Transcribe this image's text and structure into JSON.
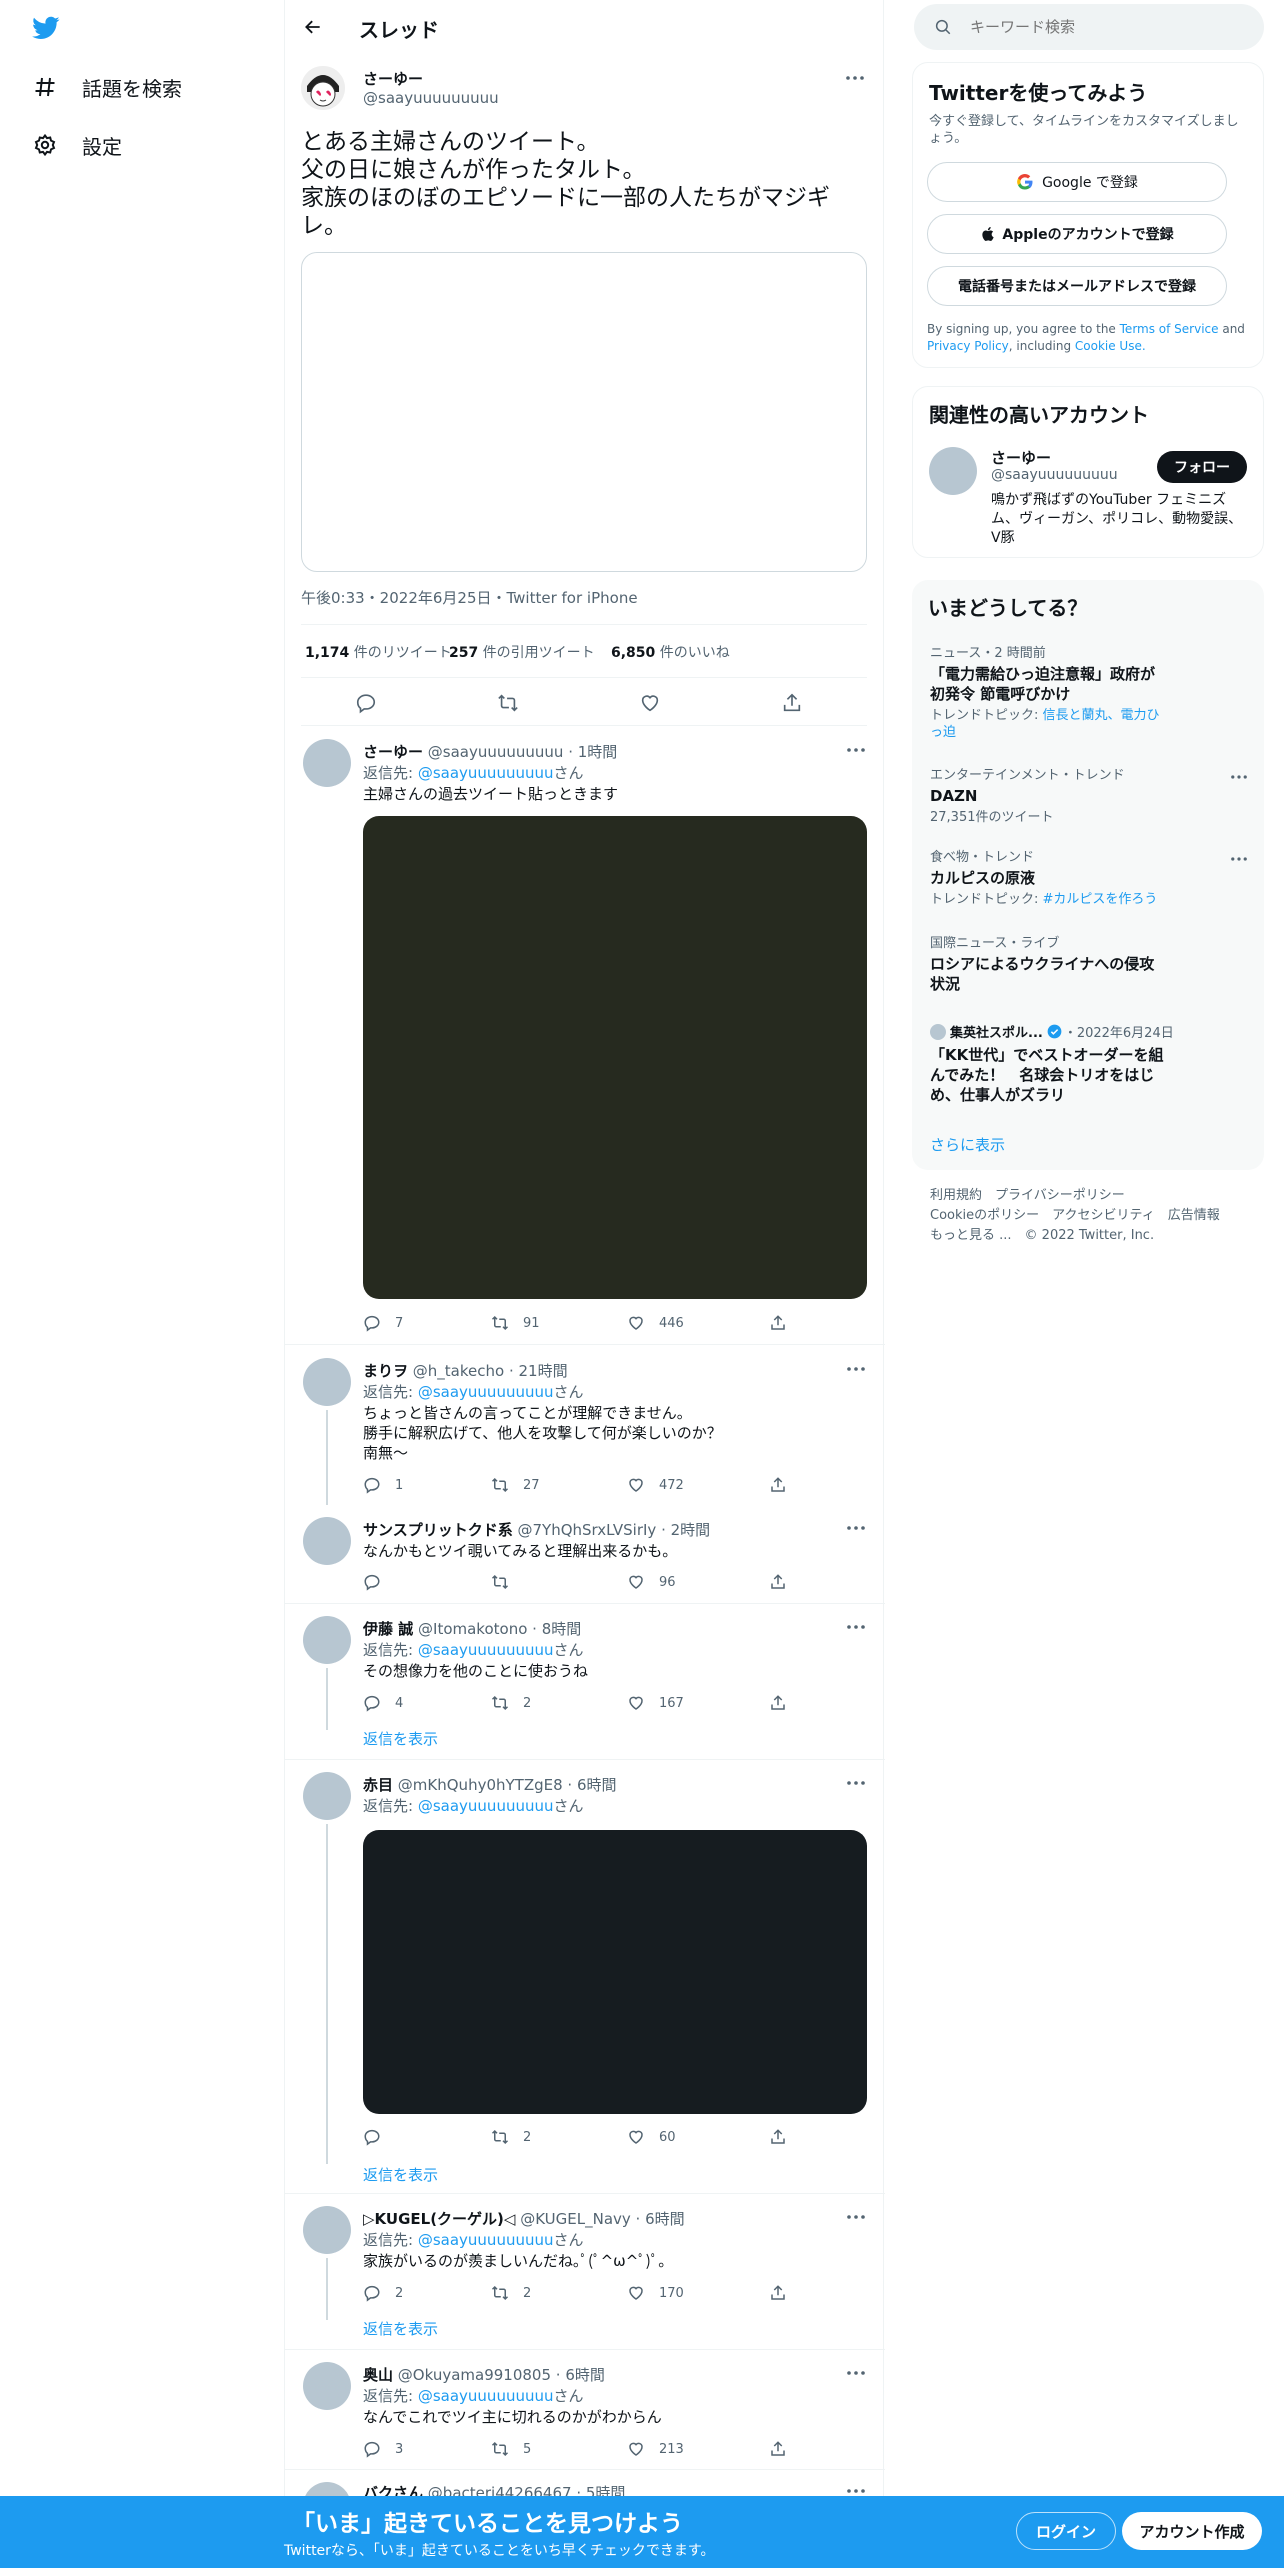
{
  "nav": {
    "items": [
      {
        "label": "話題を検索",
        "icon": "hashtag-icon"
      },
      {
        "label": "設定",
        "icon": "gear-icon"
      }
    ]
  },
  "header": {
    "title": "スレッド"
  },
  "main_tweet": {
    "name": "さーゆー",
    "handle": "@saayuuuuuuuuu",
    "text": "とある主婦さんのツイート。\n父の日に娘さんが作ったタルト。\n家族のほのぼのエピソードに一部の人たちがマジギレ。",
    "meta": "午後0:33・2022年6月25日・Twitter for iPhone",
    "stats": {
      "retweets": "1,174",
      "retweets_label": "件のリツイート",
      "quotes": "257",
      "quotes_label": "件の引用ツイート",
      "likes": "6,850",
      "likes_label": "件のいいね"
    }
  },
  "replies": [
    {
      "name": "さーゆー",
      "handle": "@saayuuuuuuuuu",
      "time": "1時間",
      "reply_to": "返信先:",
      "reply_handle": "@saayuuuuuuuuu",
      "reply_suffix": "さん",
      "text": "主婦さんの過去ツイート貼っときます",
      "replies": "7",
      "retweets": "91",
      "likes": "446",
      "media_color": "#262a1f"
    },
    {
      "name": "まりヲ",
      "handle": "@h_takecho",
      "time": "21時間",
      "reply_to": "返信先:",
      "reply_handle": "@saayuuuuuuuuu",
      "reply_suffix": "さん",
      "text": "ちょっと皆さんの言ってことが理解できません。\n勝手に解釈広げて、他人を攻撃して何が楽しいのか？\n南無〜",
      "replies": "1",
      "retweets": "27",
      "likes": "472"
    },
    {
      "name": "サンスプリットクド系",
      "handle": "@7YhQhSrxLVSirIy",
      "time": "2時間",
      "text": "なんかもとツイ覗いてみると理解出来るかも。",
      "replies": "",
      "retweets": "",
      "likes": "96"
    },
    {
      "name": "伊藤 誠",
      "handle": "@Itomakotono",
      "time": "8時間",
      "reply_to": "返信先:",
      "reply_handle": "@saayuuuuuuuuu",
      "reply_suffix": "さん",
      "text": "その想像力を他のことに使おうね",
      "replies": "4",
      "retweets": "2",
      "likes": "167",
      "show_replies": "返信を表示"
    },
    {
      "name": "赤目",
      "handle": "@mKhQuhy0hYTZgE8",
      "time": "6時間",
      "reply_to": "返信先:",
      "reply_handle": "@saayuuuuuuuuu",
      "reply_suffix": "さん",
      "replies": "",
      "retweets": "2",
      "likes": "60",
      "show_replies": "返信を表示",
      "media_color": "#161c20"
    },
    {
      "name": "▷KUGEL(クーゲル)◁",
      "handle": "@KUGEL_Navy",
      "time": "6時間",
      "reply_to": "返信先:",
      "reply_handle": "@saayuuuuuuuuu",
      "reply_suffix": "さん",
      "text": "家族がいるのが羨ましいんだね｡ﾟ(ﾟ^ω^ﾟ)ﾟ｡",
      "replies": "2",
      "retweets": "2",
      "likes": "170",
      "show_replies": "返信を表示"
    },
    {
      "name": "奥山",
      "handle": "@Okuyama9910805",
      "time": "6時間",
      "reply_to": "返信先:",
      "reply_handle": "@saayuuuuuuuuu",
      "reply_suffix": "さん",
      "text": "なんでこれでツイ主に切れるのかがわからん",
      "replies": "3",
      "retweets": "5",
      "likes": "213"
    },
    {
      "name": "バクさん",
      "handle": "@bacteri44266467",
      "time": "5時間"
    }
  ],
  "search": {
    "placeholder": "キーワード検索"
  },
  "signup": {
    "title": "Twitterを使ってみよう",
    "subtitle": "今すぐ登録して、タイムラインをカスタマイズしましょう。",
    "google": "Google で登録",
    "apple": "Appleのアカウントで登録",
    "phone": "電話番号またはメールアドレスで登録",
    "terms_prefix": "By signing up, you agree to the ",
    "terms": "Terms of Service",
    "and": " and ",
    "privacy": "Privacy Policy",
    "including": ", including ",
    "cookie": "Cookie Use."
  },
  "related": {
    "title": "関連性の高いアカウント",
    "name": "さーゆー",
    "handle": "@saayuuuuuuuuu",
    "follow": "フォロー",
    "bio": "鳴かず飛ばずのYouTuber フェミニズム、ヴィーガン、ポリコレ、動物愛誤、V豚"
  },
  "trends": {
    "title": "いまどうしてる？",
    "items": [
      {
        "category": "ニュース・2 時間前",
        "title": "「電力需給ひっ迫注意報」政府が\n初発令 節電呼びかけ",
        "sub_prefix": "トレンドトピック: ",
        "sub_link": "信長と蘭丸、電力ひっ迫"
      },
      {
        "category": "エンターテインメント・トレンド",
        "title": "DAZN",
        "sub": "27,351件のツイート"
      },
      {
        "category": "食べ物・トレンド",
        "title": "カルピスの原液",
        "sub_prefix": "トレンドトピック: ",
        "sub_link": "#カルピスを作ろう"
      },
      {
        "category": "国際ニュース・ライブ",
        "title": "ロシアによるウクライナへの侵攻\n状況"
      },
      {
        "source": "集英社スポル...",
        "date": "・2022年6月24日",
        "title": "「KK世代」でベストオーダーを組\nんでみた！　名球会トリオをはじ\nめ、仕事人がズラリ"
      }
    ],
    "show_more": "さらに表示"
  },
  "footer": {
    "line1": [
      "利用規約",
      "プライバシーポリシー"
    ],
    "line2": [
      "Cookieのポリシー",
      "アクセシビリティ",
      "広告情報"
    ],
    "line3": [
      "もっと見る ...",
      "© 2022 Twitter, Inc."
    ]
  },
  "bottom": {
    "title": "「いま」起きていることを見つけよう",
    "subtitle": "Twitterなら、「いま」起きていることをいち早くチェックできます。",
    "login": "ログイン",
    "signup": "アカウント作成"
  },
  "colors": {
    "accent": "#1d9bf0",
    "text": "#0f1419",
    "muted": "#536471"
  }
}
